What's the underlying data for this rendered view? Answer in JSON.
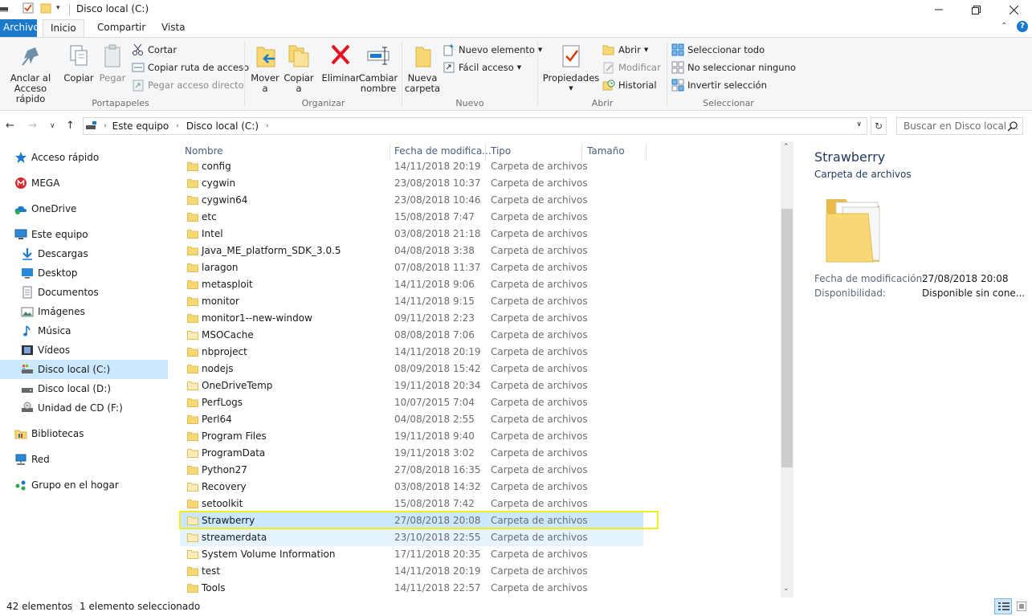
{
  "window": {
    "title": "Disco local (C:)"
  },
  "tabs": {
    "archivo": "Archivo",
    "inicio": "Inicio",
    "compartir": "Compartir",
    "vista": "Vista"
  },
  "ribbon": {
    "portapapeles": {
      "label": "Portapapeles",
      "anclar_l1": "Anclar al",
      "anclar_l2": "Acceso rápido",
      "copiar": "Copiar",
      "pegar": "Pegar",
      "cortar": "Cortar",
      "copiar_ruta": "Copiar ruta de acceso",
      "pegar_acceso": "Pegar acceso directo"
    },
    "organizar": {
      "label": "Organizar",
      "mover_l1": "Mover",
      "mover_l2": "a",
      "copiar_l1": "Copiar",
      "copiar_l2": "a",
      "eliminar": "Eliminar",
      "cambiar_l1": "Cambiar",
      "cambiar_l2": "nombre"
    },
    "nuevo": {
      "label": "Nuevo",
      "carpeta_l1": "Nueva",
      "carpeta_l2": "carpeta",
      "nuevo_elemento": "Nuevo elemento",
      "facil_acceso": "Fácil acceso"
    },
    "abrir": {
      "label": "Abrir",
      "propiedades": "Propiedades",
      "abrir": "Abrir",
      "modificar": "Modificar",
      "historial": "Historial"
    },
    "seleccionar": {
      "label": "Seleccionar",
      "todo": "Seleccionar todo",
      "ninguno": "No seleccionar ninguno",
      "invertir": "Invertir selección"
    }
  },
  "address": {
    "crumbs": [
      "Este equipo",
      "Disco local (C:)"
    ],
    "search_placeholder": "Buscar en Disco local ..."
  },
  "nav": {
    "items": [
      {
        "label": "Acceso rápido",
        "icon": "star-icon"
      },
      {
        "label": "MEGA",
        "icon": "mega-icon"
      },
      {
        "label": "OneDrive",
        "icon": "onedrive-icon"
      },
      {
        "label": "Este equipo",
        "icon": "computer-icon"
      },
      {
        "label": "Descargas",
        "icon": "download-icon"
      },
      {
        "label": "Desktop",
        "icon": "desktop-icon"
      },
      {
        "label": "Documentos",
        "icon": "documents-icon"
      },
      {
        "label": "Imágenes",
        "icon": "pictures-icon"
      },
      {
        "label": "Música",
        "icon": "music-icon"
      },
      {
        "label": "Vídeos",
        "icon": "videos-icon"
      },
      {
        "label": "Disco local (C:)",
        "icon": "drive-c-icon"
      },
      {
        "label": "Disco local (D:)",
        "icon": "drive-d-icon"
      },
      {
        "label": "Unidad de CD (F:)",
        "icon": "cd-drive-icon"
      },
      {
        "label": "Bibliotecas",
        "icon": "libraries-icon"
      },
      {
        "label": "Red",
        "icon": "network-icon"
      },
      {
        "label": "Grupo en el hogar",
        "icon": "homegroup-icon"
      }
    ]
  },
  "columns": {
    "name": "Nombre",
    "date": "Fecha de modifica...",
    "type": "Tipo",
    "size": "Tamaño"
  },
  "files": [
    {
      "name": "config",
      "date": "14/11/2018 20:19",
      "type": "Carpeta de archivos"
    },
    {
      "name": "cygwin",
      "date": "23/08/2018 10:37",
      "type": "Carpeta de archivos"
    },
    {
      "name": "cygwin64",
      "date": "23/08/2018 10:46",
      "type": "Carpeta de archivos"
    },
    {
      "name": "etc",
      "date": "15/08/2018 7:47",
      "type": "Carpeta de archivos"
    },
    {
      "name": "Intel",
      "date": "03/08/2018 21:18",
      "type": "Carpeta de archivos"
    },
    {
      "name": "Java_ME_platform_SDK_3.0.5",
      "date": "04/08/2018 3:38",
      "type": "Carpeta de archivos"
    },
    {
      "name": "laragon",
      "date": "07/08/2018 11:37",
      "type": "Carpeta de archivos"
    },
    {
      "name": "metasploit",
      "date": "14/11/2018 9:06",
      "type": "Carpeta de archivos"
    },
    {
      "name": "monitor",
      "date": "14/11/2018 9:15",
      "type": "Carpeta de archivos"
    },
    {
      "name": "monitor1--new-window",
      "date": "09/11/2018 2:23",
      "type": "Carpeta de archivos"
    },
    {
      "name": "MSOCache",
      "date": "08/08/2018 7:06",
      "type": "Carpeta de archivos"
    },
    {
      "name": "nbproject",
      "date": "14/11/2018 20:19",
      "type": "Carpeta de archivos"
    },
    {
      "name": "nodejs",
      "date": "08/09/2018 15:42",
      "type": "Carpeta de archivos"
    },
    {
      "name": "OneDriveTemp",
      "date": "19/11/2018 20:34",
      "type": "Carpeta de archivos"
    },
    {
      "name": "PerfLogs",
      "date": "10/07/2015 7:04",
      "type": "Carpeta de archivos"
    },
    {
      "name": "Perl64",
      "date": "04/08/2018 2:55",
      "type": "Carpeta de archivos"
    },
    {
      "name": "Program Files",
      "date": "19/11/2018 9:40",
      "type": "Carpeta de archivos"
    },
    {
      "name": "ProgramData",
      "date": "19/11/2018 3:02",
      "type": "Carpeta de archivos"
    },
    {
      "name": "Python27",
      "date": "27/08/2018 16:35",
      "type": "Carpeta de archivos"
    },
    {
      "name": "Recovery",
      "date": "03/08/2018 14:32",
      "type": "Carpeta de archivos"
    },
    {
      "name": "setoolkit",
      "date": "15/08/2018 7:42",
      "type": "Carpeta de archivos"
    },
    {
      "name": "Strawberry",
      "date": "27/08/2018 20:08",
      "type": "Carpeta de archivos"
    },
    {
      "name": "streamerdata",
      "date": "23/10/2018 22:55",
      "type": "Carpeta de archivos"
    },
    {
      "name": "System Volume Information",
      "date": "17/11/2018 20:35",
      "type": "Carpeta de archivos"
    },
    {
      "name": "test",
      "date": "14/11/2018 20:19",
      "type": "Carpeta de archivos"
    },
    {
      "name": "Tools",
      "date": "14/11/2018 22:57",
      "type": "Carpeta de archivos"
    }
  ],
  "details": {
    "name": "Strawberry",
    "kind": "Carpeta de archivos",
    "mod_label": "Fecha de modificación:",
    "mod_value": "27/08/2018 20:08",
    "avail_label": "Disponibilidad:",
    "avail_value": "Disponible sin cone..."
  },
  "status": {
    "count": "42 elementos",
    "selected": "1 elemento seleccionado"
  },
  "colors": {
    "accent": "#1979ca",
    "selection": "#cce8ff",
    "folder": "#f8d775",
    "highlight": "#f1ed20"
  }
}
